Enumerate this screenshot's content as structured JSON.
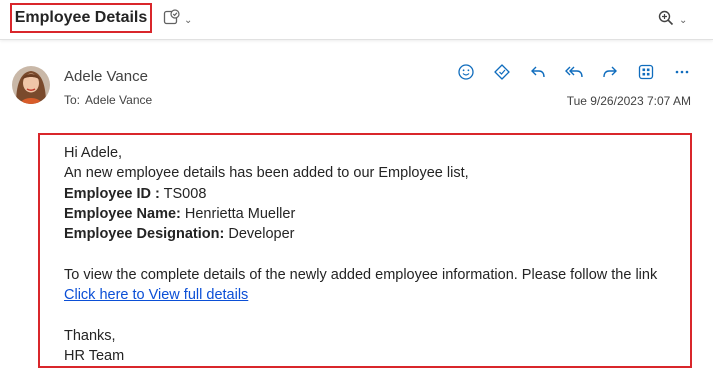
{
  "header": {
    "subject": "Employee Details",
    "status_icon": "check-clipboard-icon",
    "zoom_icon": "zoom-in-icon",
    "chevron_icon": "chevron-down-icon"
  },
  "message": {
    "sender_name": "Adele Vance",
    "to_label": "To:",
    "to_name": "Adele Vance",
    "date": "Tue 9/26/2023 7:07 AM",
    "actions": [
      "emoji-icon",
      "sticker-icon",
      "reply-icon",
      "reply-all-icon",
      "forward-icon",
      "apps-icon",
      "more-icon"
    ]
  },
  "body": {
    "greeting": "Hi Adele,",
    "intro": "An new employee details has been added to our Employee list,",
    "emp_id_label": "Employee ID :",
    "emp_id_value": " TS008",
    "emp_name_label": "Employee Name:",
    "emp_name_value": " Henrietta Mueller",
    "emp_desig_label": "Employee Designation:",
    "emp_desig_value": " Developer",
    "instruction": "To view the complete details of the newly added employee information. Please follow the link",
    "link_text": "Click here to View full details",
    "thanks": "Thanks,",
    "signature": "HR Team"
  },
  "colors": {
    "highlight_border": "#d9262b",
    "accent": "#0f6cbd",
    "link": "#0b4fd6"
  }
}
